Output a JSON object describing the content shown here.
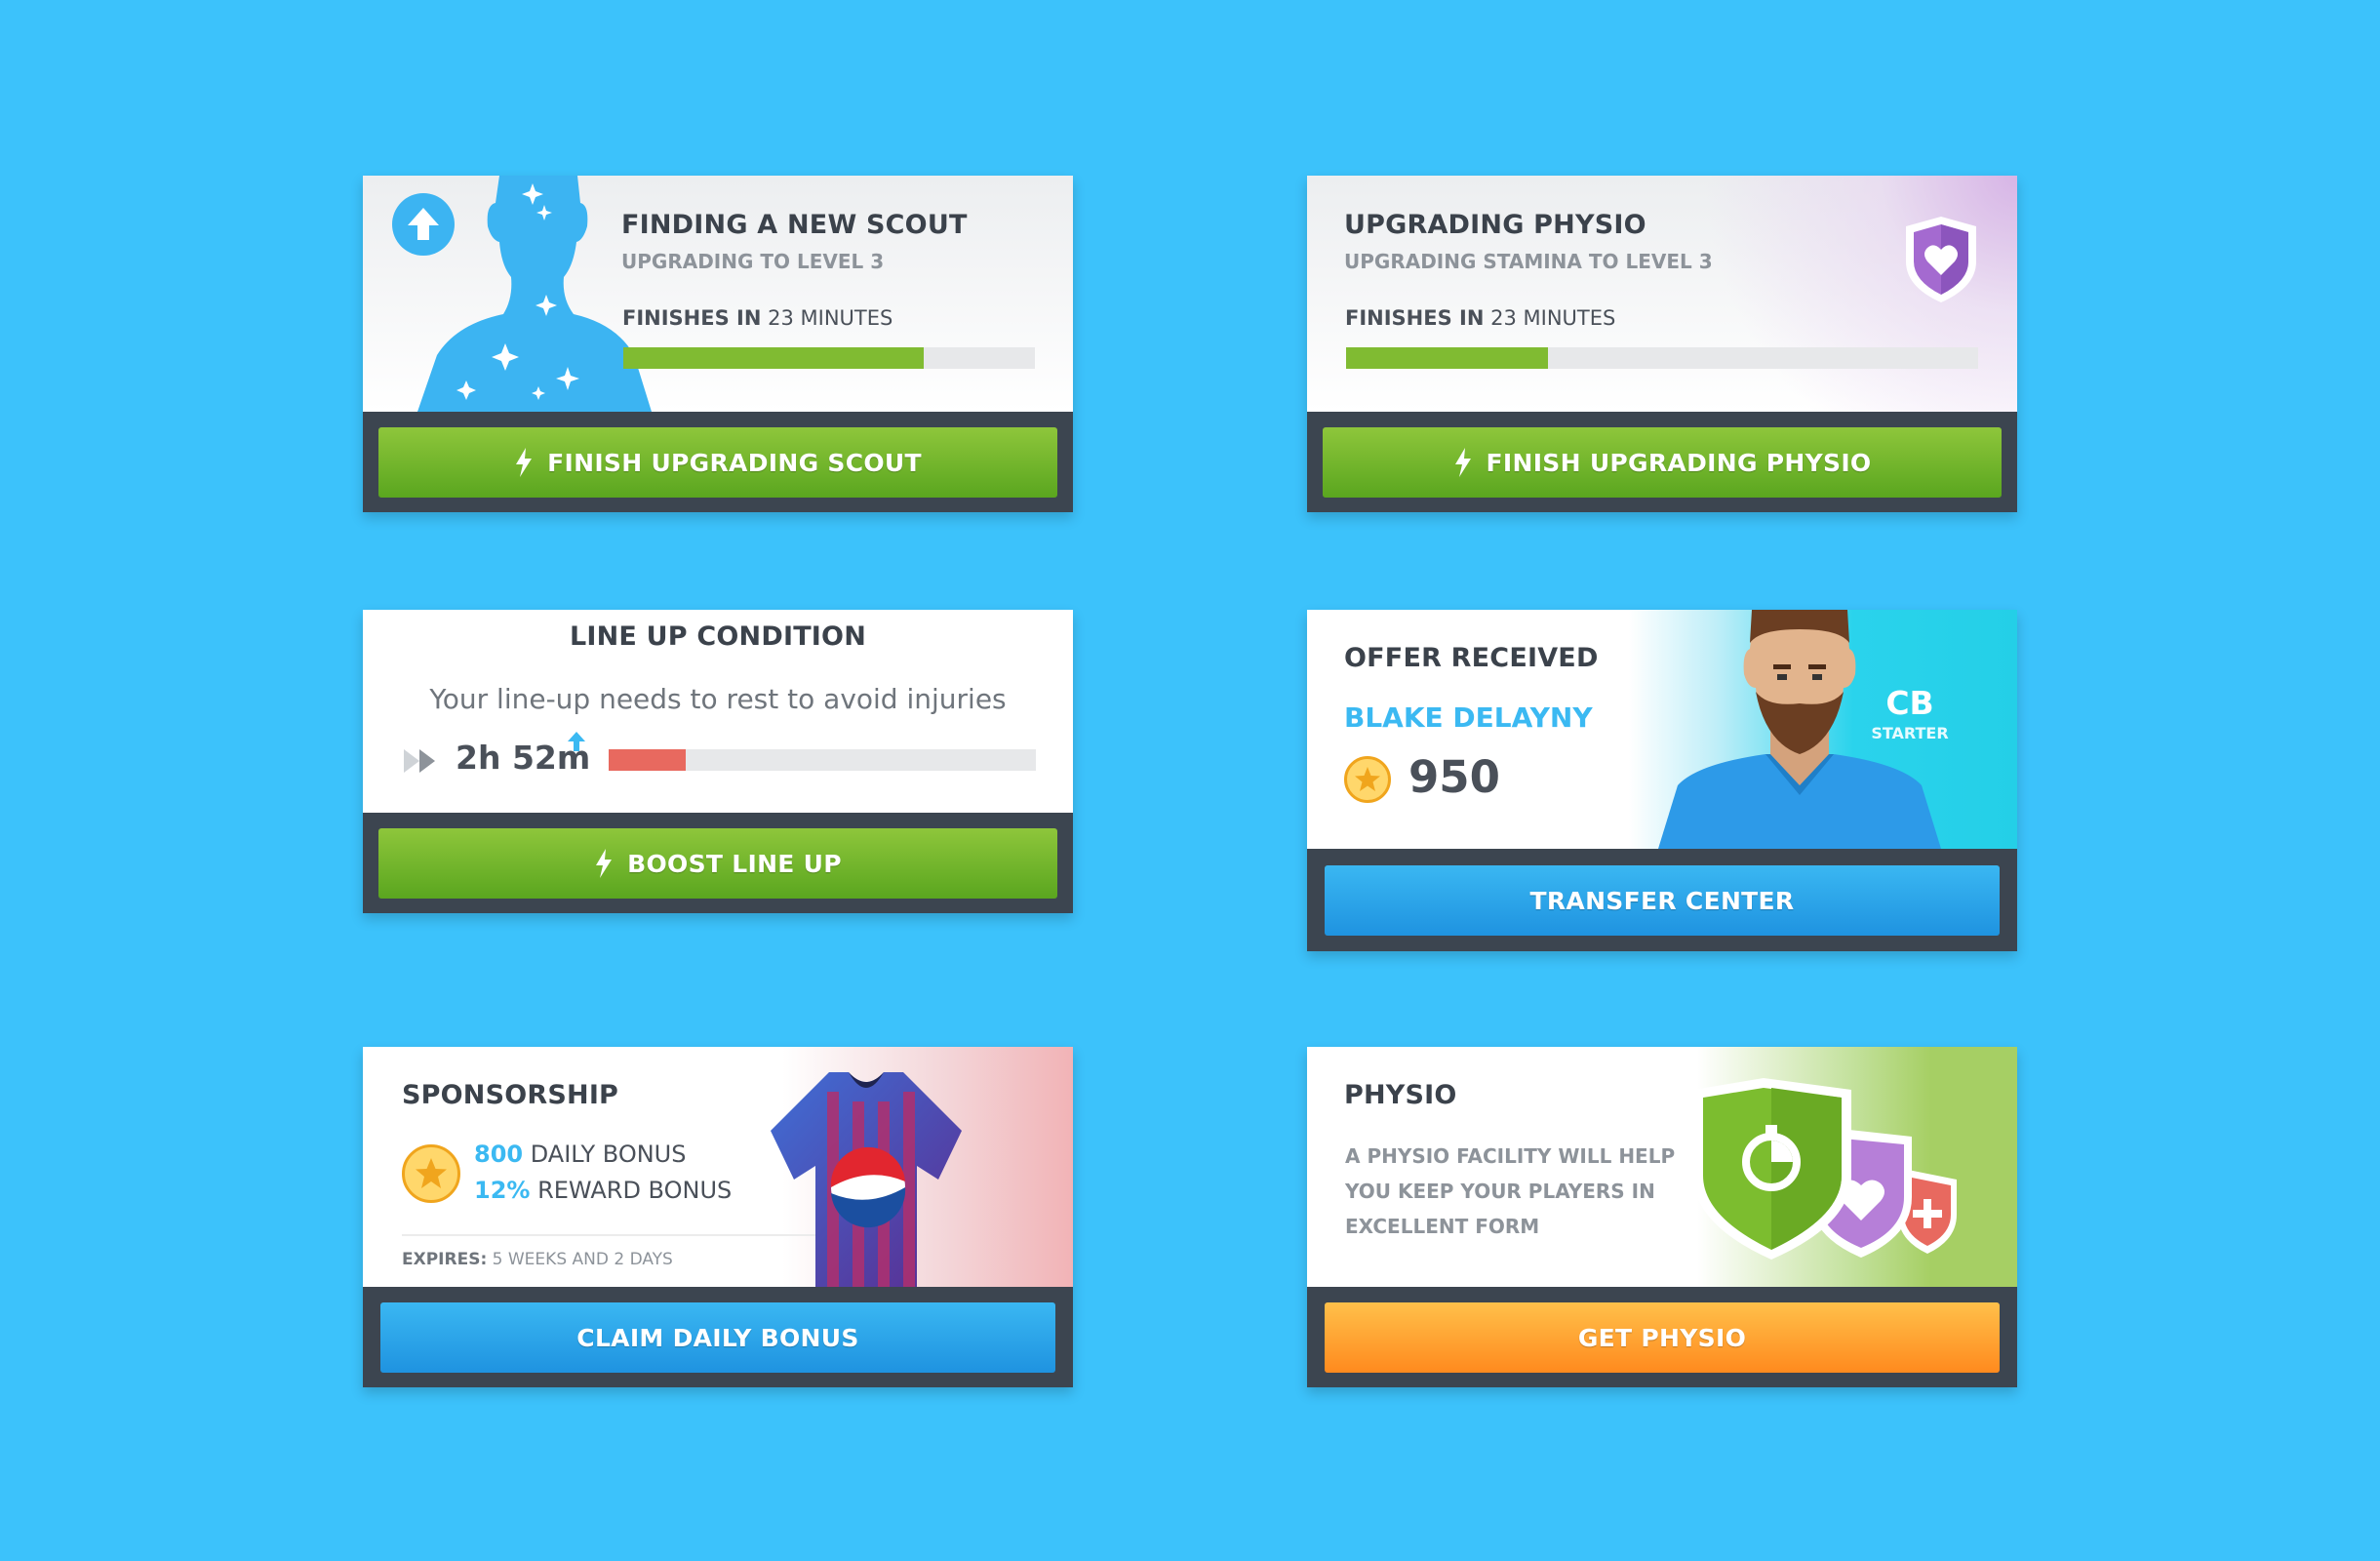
{
  "scout": {
    "title": "FINDING A NEW SCOUT",
    "subtitle": "UPGRADING TO LEVEL 3",
    "finishes_label": "FINISHES IN",
    "finishes_value": "23 MINUTES",
    "progress": 0.73,
    "button": "FINISH UPGRADING SCOUT",
    "icon": "arrow-up-icon"
  },
  "physio_upgrade": {
    "title": "UPGRADING PHYSIO",
    "subtitle": "UPGRADING STAMINA TO LEVEL 3",
    "finishes_label": "FINISHES IN",
    "finishes_value": "23 MINUTES",
    "progress": 0.32,
    "button": "FINISH UPGRADING PHYSIO",
    "icon": "heart-shield-icon"
  },
  "lineup": {
    "title": "LINE UP CONDITION",
    "message": "Your line-up needs to rest to avoid injuries",
    "timer": "2h 52m",
    "progress": 0.18,
    "button": "BOOST LINE UP"
  },
  "offer": {
    "title": "OFFER RECEIVED",
    "player_name": "BLAKE DELAYNY",
    "amount": "950",
    "position": "CB",
    "role": "STARTER",
    "button": "TRANSFER CENTER"
  },
  "sponsorship": {
    "title": "SPONSORSHIP",
    "daily_value": "800",
    "daily_label": "DAILY BONUS",
    "reward_value": "12%",
    "reward_label": "REWARD BONUS",
    "expires_label": "EXPIRES:",
    "expires_value": "5 WEEKS AND 2 DAYS",
    "button": "CLAIM DAILY BONUS"
  },
  "physio": {
    "title": "PHYSIO",
    "description_1": "A PHYSIO FACILITY WILL HELP",
    "description_2": "YOU KEEP YOUR PLAYERS IN",
    "description_3": "EXCELLENT FORM",
    "button": "GET PHYSIO"
  },
  "colors": {
    "background": "#3cc2fb",
    "green": "#7cbd2f",
    "blue": "#27a6ec",
    "orange": "#ff9a26",
    "red": "#e8695f",
    "accent_text": "#3bb9f2"
  }
}
